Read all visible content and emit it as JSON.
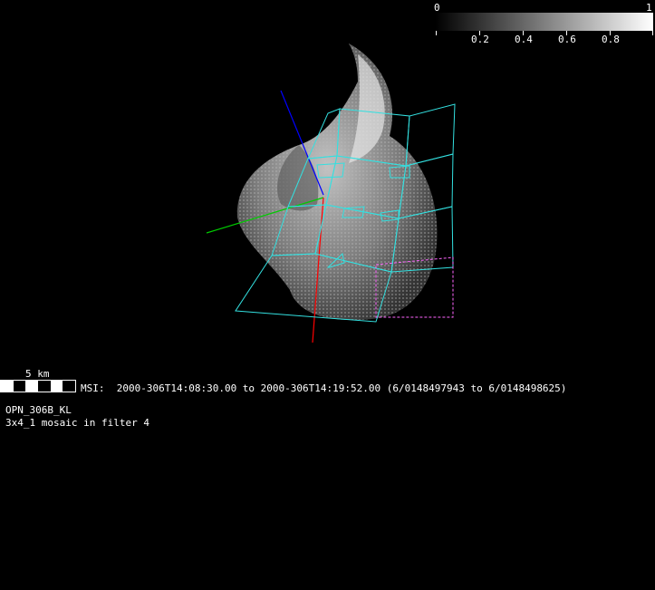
{
  "colorbar": {
    "min_label": "0",
    "max_label": "1",
    "tick_labels": [
      "0.2",
      "0.4",
      "0.6",
      "0.8"
    ]
  },
  "scale": {
    "label": "5 km"
  },
  "info": {
    "msi_line": "MSI:  2000-306T14:08:30.00 to 2000-306T14:19:52.00 (6/0148497943 to 6/0148498625)",
    "observation": "OPN_306B_KL",
    "mosaic": "3x4_1 mosaic in filter 4"
  },
  "colors": {
    "footprint": "#33e0e0",
    "footprint_highlight": "#ff66ff",
    "axis_x": "#ff0000",
    "axis_y": "#00cc00",
    "axis_z": "#0000ff"
  }
}
